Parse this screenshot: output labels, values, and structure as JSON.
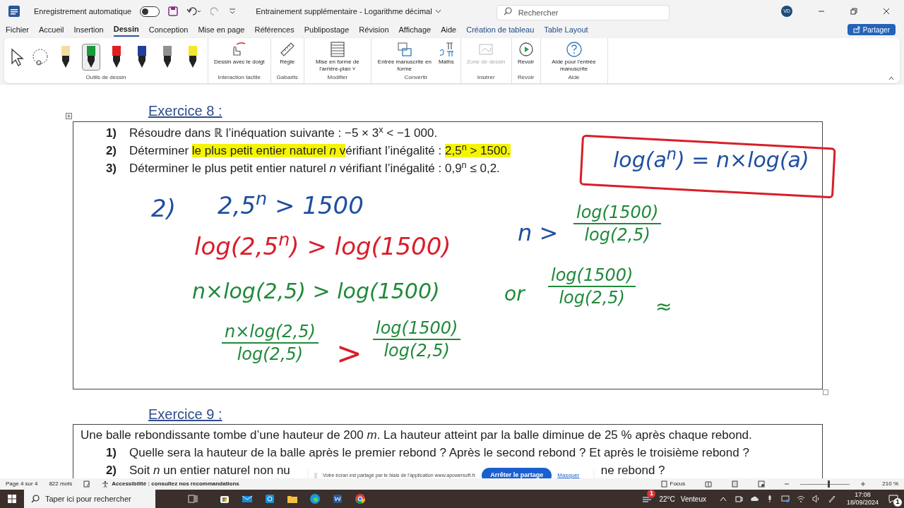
{
  "title_bar": {
    "autosave_label": "Enregistrement automatique",
    "autosave_on": false,
    "document_title": "Entrainement supplémentaire - Logarithme décimal",
    "search": {
      "placeholder": "Rechercher"
    },
    "avatar": "VD"
  },
  "menu_tabs": [
    {
      "label": "Fichier",
      "selected": false,
      "kind": "standard"
    },
    {
      "label": "Accueil",
      "selected": false,
      "kind": "standard"
    },
    {
      "label": "Insertion",
      "selected": false,
      "kind": "standard"
    },
    {
      "label": "Dessin",
      "selected": true,
      "kind": "standard"
    },
    {
      "label": "Conception",
      "selected": false,
      "kind": "standard"
    },
    {
      "label": "Mise en page",
      "selected": false,
      "kind": "standard"
    },
    {
      "label": "Références",
      "selected": false,
      "kind": "standard"
    },
    {
      "label": "Publipostage",
      "selected": false,
      "kind": "standard"
    },
    {
      "label": "Révision",
      "selected": false,
      "kind": "standard"
    },
    {
      "label": "Affichage",
      "selected": false,
      "kind": "standard"
    },
    {
      "label": "Aide",
      "selected": false,
      "kind": "standard"
    },
    {
      "label": "Création de tableau",
      "selected": false,
      "kind": "contextual"
    },
    {
      "label": "Table Layout",
      "selected": false,
      "kind": "contextual"
    }
  ],
  "share_button": "Partager",
  "ribbon_groups": [
    {
      "label": "Outils de dessin",
      "kind": "pens",
      "pens": [
        {
          "color": "#f0e0a0",
          "selected": false
        },
        {
          "color": "#1a9a3a",
          "selected": true
        },
        {
          "color": "#e02020",
          "selected": false
        },
        {
          "color": "#1f3f9a",
          "selected": false
        },
        {
          "color": "#909090",
          "selected": false
        },
        {
          "color": "#f5e62a",
          "selected": false
        }
      ]
    },
    {
      "label": "Interaction tactile",
      "kind": "buttons",
      "buttons": [
        {
          "label": "Dessin avec le doigt",
          "disabled": false
        }
      ]
    },
    {
      "label": "Gabarits",
      "kind": "buttons",
      "buttons": [
        {
          "label": "Règle",
          "disabled": false
        }
      ]
    },
    {
      "label": "Modifier",
      "kind": "buttons",
      "buttons": [
        {
          "label": "Mise en forme de l'arrière-plan ˅",
          "disabled": false
        }
      ]
    },
    {
      "label": "Convertir",
      "kind": "buttons",
      "buttons": [
        {
          "label": "Entrée manuscrite en forme",
          "disabled": false
        },
        {
          "label": "Maths",
          "disabled": false
        }
      ]
    },
    {
      "label": "Insérer",
      "kind": "buttons",
      "buttons": [
        {
          "label": "Zone de dessin",
          "disabled": true
        }
      ]
    },
    {
      "label": "Revoir",
      "kind": "buttons",
      "buttons": [
        {
          "label": "Revoir",
          "disabled": false
        }
      ]
    },
    {
      "label": "Aide",
      "kind": "buttons",
      "buttons": [
        {
          "label": "Aide pour l'entrée manuscrite",
          "disabled": false
        }
      ]
    }
  ],
  "exercise_8": {
    "title": "Exercice 8 :",
    "items": [
      {
        "number": "1)",
        "segments": [
          {
            "text": "Résoudre dans ℝ l’inéquation suivante : −5 × 3$^{x}$ < −1 000.",
            "highlighted": false
          }
        ]
      },
      {
        "number": "2)",
        "segments": [
          {
            "text": "Déterminer ",
            "highlighted": false
          },
          {
            "text": "le plus petit entier naturel *n* v",
            "highlighted": true
          },
          {
            "text": "érifiant l’inégalité : ",
            "highlighted": false
          },
          {
            "text": " 2,5$^{n}$ > 1500. ",
            "highlighted": true
          }
        ]
      },
      {
        "number": "3)",
        "segments": [
          {
            "text": "Déterminer le plus petit entier naturel *n* vérifiant l’inégalité : 0,9$^{n}$ ≤ 0,2.",
            "highlighted": false
          }
        ]
      }
    ]
  },
  "ink_annotations": [
    {
      "kind": "box",
      "color": "#d81e2a"
    },
    {
      "kind": "text",
      "color": "#1f4fa0",
      "text": "log(a$^{n}$) = n×log(a)"
    },
    {
      "kind": "text",
      "color": "#1f4fa0",
      "text": "2)"
    },
    {
      "kind": "text",
      "color": "#1f4fa0",
      "text": "2,5$^{n}$ > 1500"
    },
    {
      "kind": "text",
      "color": "#d81e2a",
      "text": "log(2,5$^{n}$) > log(1500)"
    },
    {
      "kind": "text",
      "color": "#1f8a3a",
      "text": "n×log(2,5) > log(1500)"
    },
    {
      "kind": "fraction",
      "color": "#1f8a3a",
      "numerator": "n×log(2,5)",
      "denominator": "log(2,5)"
    },
    {
      "kind": "text",
      "color": "#d81e2a",
      "text": ">"
    },
    {
      "kind": "fraction",
      "color": "#1f8a3a",
      "numerator": "log(1500)",
      "denominator": "log(2,5)"
    },
    {
      "kind": "text",
      "color": "#1f4fa0",
      "text": "n >"
    },
    {
      "kind": "fraction",
      "color": "#1f8a3a",
      "numerator": "log(1500)",
      "denominator": "log(2,5)"
    },
    {
      "kind": "text",
      "color": "#1f8a3a",
      "text": "or"
    },
    {
      "kind": "fraction",
      "color": "#1f8a3a",
      "numerator": "log(1500)",
      "denominator": "log(2,5)"
    },
    {
      "kind": "text",
      "color": "#1f8a3a",
      "text": "≈"
    }
  ],
  "exercise_9": {
    "title": "Exercice 9 :",
    "intro": "Une balle rebondissante tombe d’une hauteur de 200 *m*. La hauteur atteint par la balle diminue de 25 % après chaque rebond.",
    "items": [
      {
        "number": "1)",
        "text": "Quelle sera la hauteur de la balle après le premier rebond ? Après le second rebond ? Et après le troisième rebond ?"
      },
      {
        "number": "2)",
        "text": "Soit *n* un entier naturel non nu",
        "text_after": "ne rebond ?"
      }
    ]
  },
  "share_notice": {
    "text": "Votre écran est partagé par le biais de l'application www.apowersoft.fr.",
    "stop_button": "Arrêter le partage",
    "hide_link": "Masquer"
  },
  "status_bar": {
    "page": "Page 4 sur 4",
    "words": "822 mots",
    "accessibility": "Accessibilité : consultez nos recommandations",
    "focus": "Focus",
    "zoom": {
      "level": 0.57,
      "reading": "210 %"
    }
  },
  "taskbar": {
    "search": {
      "placeholder": "Taper ici pour rechercher"
    },
    "weather": {
      "badge": "1",
      "temperature": "22°C",
      "condition": "Venteux"
    },
    "time": "17:08",
    "date": "18/09/2024",
    "notifications": "1"
  }
}
